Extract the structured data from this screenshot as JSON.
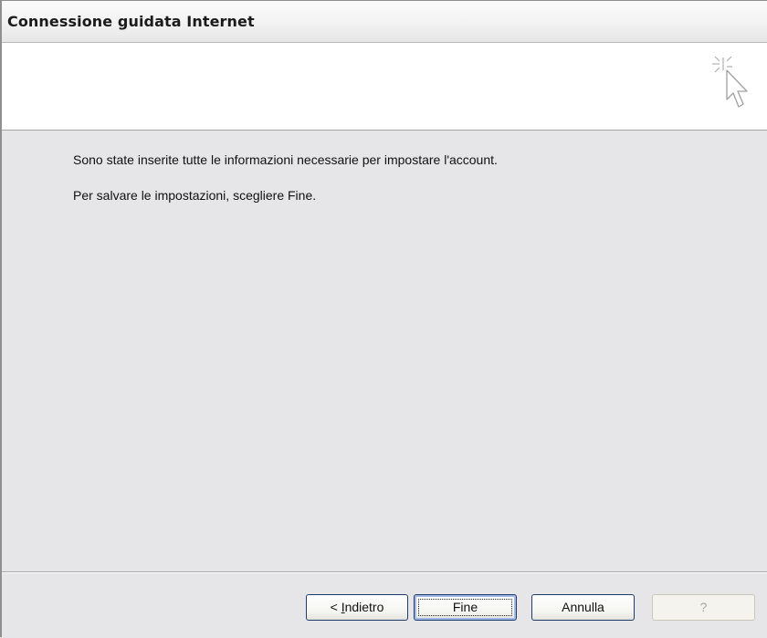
{
  "window": {
    "title": "Connessione guidata Internet"
  },
  "header": {
    "icon": "wizard-cursor-icon"
  },
  "content": {
    "line1": "Sono state inserite tutte le informazioni necessarie per impostare l'account.",
    "line2": "Per salvare le impostazioni, scegliere Fine."
  },
  "buttons": {
    "back_prefix": "< ",
    "back_accel": "I",
    "back_rest": "ndietro",
    "finish": "Fine",
    "cancel": "Annulla",
    "help": "?"
  },
  "colors": {
    "panel_bg": "#e6e5e8",
    "header_bg": "#ffffff",
    "button_border": "#1f3c6a",
    "focus_ring": "#9fb8e8"
  }
}
